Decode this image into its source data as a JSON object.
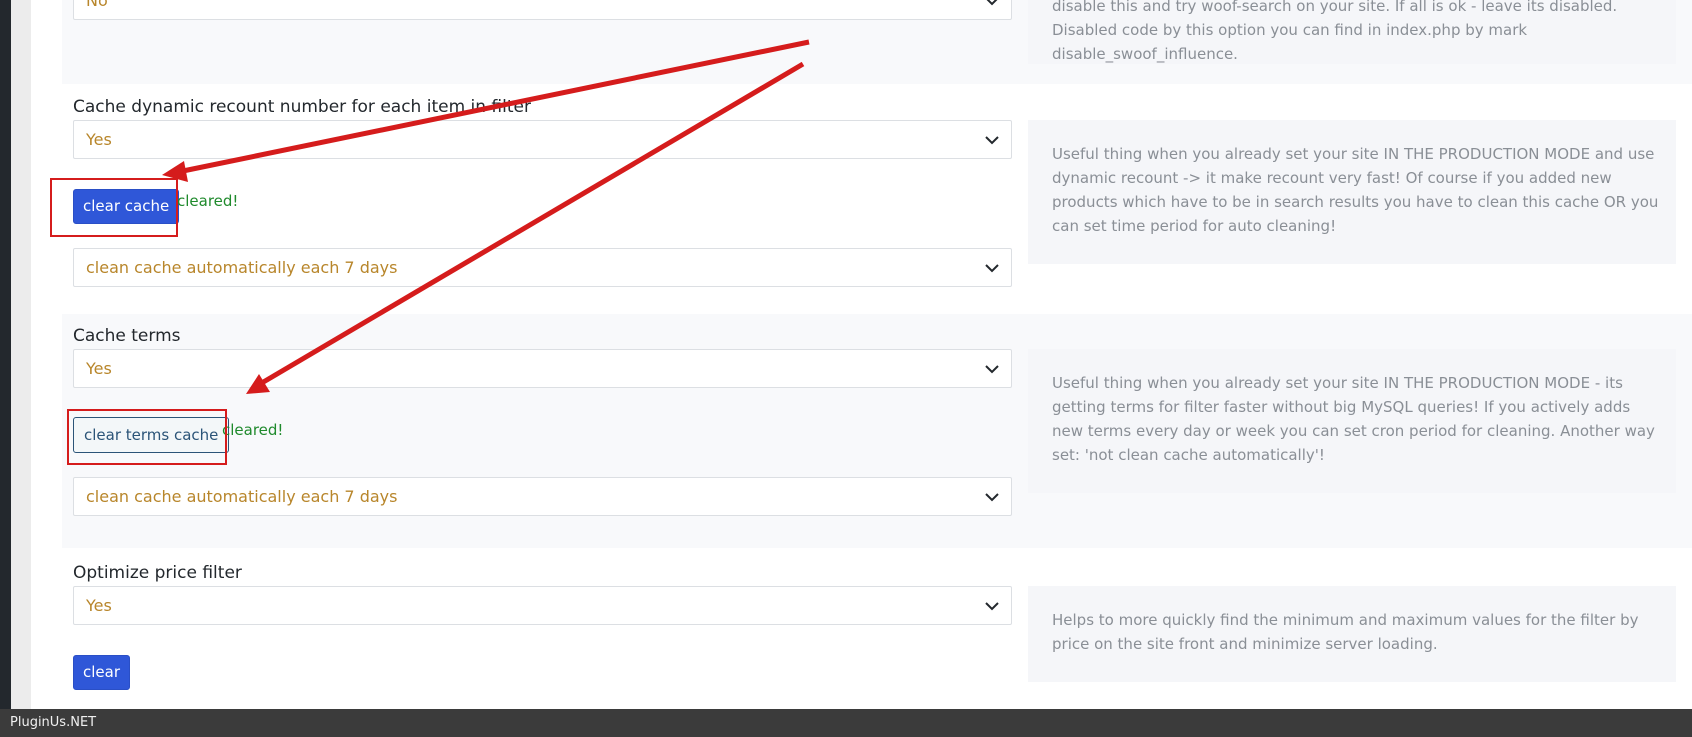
{
  "sections": {
    "influence": {
      "select_value": "No",
      "description": "disable this and try woof-search on your site. If all is ok - leave its disabled. Disabled code by this option you can find in index.php by mark disable_swoof_influence."
    },
    "cache_recount": {
      "label": "Cache dynamic recount number for each item in filter",
      "select_value": "Yes",
      "button_label": "clear cache",
      "status": "cleared!",
      "period_value": "clean cache automatically each 7 days",
      "description": "Useful thing when you already set your site IN THE PRODUCTION MODE and use dynamic recount -> it make recount very fast! Of course if you added new products which have to be in search results you have to clean this cache OR you can set time period for auto cleaning!"
    },
    "cache_terms": {
      "label": "Cache terms",
      "select_value": "Yes",
      "button_label": "clear terms cache",
      "status": "cleared!",
      "period_value": "clean cache automatically each 7 days",
      "description": "Useful thing when you already set your site IN THE PRODUCTION MODE - its getting terms for filter faster without big MySQL queries! If you actively adds new terms every day or week you can set cron period for cleaning. Another way set: 'not clean cache automatically'!"
    },
    "optimize_price": {
      "label": "Optimize price filter",
      "select_value": "Yes",
      "button_label": "clear",
      "description": "Helps to more quickly find the minimum and maximum values for the filter by price on the site front and minimize server loading."
    }
  },
  "footer": {
    "brand": "PluginUs.NET"
  },
  "colors": {
    "annotation_red": "#d51c1c",
    "primary_button": "#2f57d8",
    "select_text": "#b8862b",
    "success_text": "#1f8a2c"
  }
}
